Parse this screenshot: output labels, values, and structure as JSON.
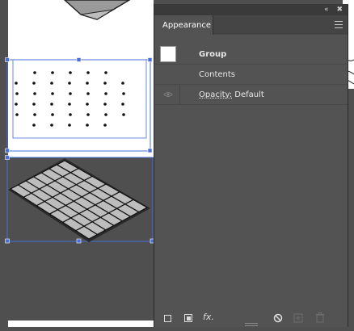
{
  "panel": {
    "title": "Appearance",
    "topbar": {
      "collapse_icon": "double-chevron-left-icon",
      "close_icon": "close-icon"
    },
    "menu_icon": "hamburger-menu-icon",
    "rows": {
      "group_label": "Group",
      "contents_label": "Contents",
      "opacity_label": "Opacity:",
      "opacity_value": "Default"
    },
    "bottom_icons": [
      "stroke-square-icon",
      "fill-square-icon",
      "fx-icon",
      "clear-appearance-icon",
      "duplicate-item-icon",
      "trash-icon"
    ],
    "fx_label": "fx."
  },
  "colors": {
    "panel_bg": "#535353",
    "tab_bg": "#535353",
    "selection": "#4a6fd8",
    "canvas": "#4f4f4f"
  }
}
